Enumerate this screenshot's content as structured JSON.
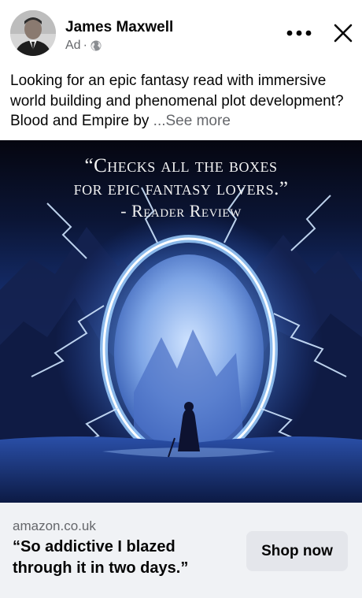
{
  "post": {
    "author_name": "James Maxwell",
    "sponsored_label": "Ad",
    "separator": "·",
    "audience_icon": "globe-icon",
    "more_icon": "more-horizontal-icon",
    "close_icon": "close-icon",
    "body_text": "Looking for an epic fantasy read with immersive world building and phenomenal plot development? Blood and Empire by ",
    "see_more_label": "...See more"
  },
  "creative": {
    "quote_line_1": "“Checks all the boxes",
    "quote_line_2": "for epic fantasy lovers.”",
    "quote_source": "- Reader Review",
    "scene": "cloaked figure before glowing lightning portal"
  },
  "link_card": {
    "domain": "amazon.co.uk",
    "headline": "“So addictive I blazed through it in two days.”",
    "cta_label": "Shop now"
  },
  "colors": {
    "text_primary": "#050505",
    "text_secondary": "#65676b",
    "footer_bg": "#f0f2f5",
    "button_bg": "#e4e6eb",
    "portal_glow": "#8fc8ff"
  }
}
